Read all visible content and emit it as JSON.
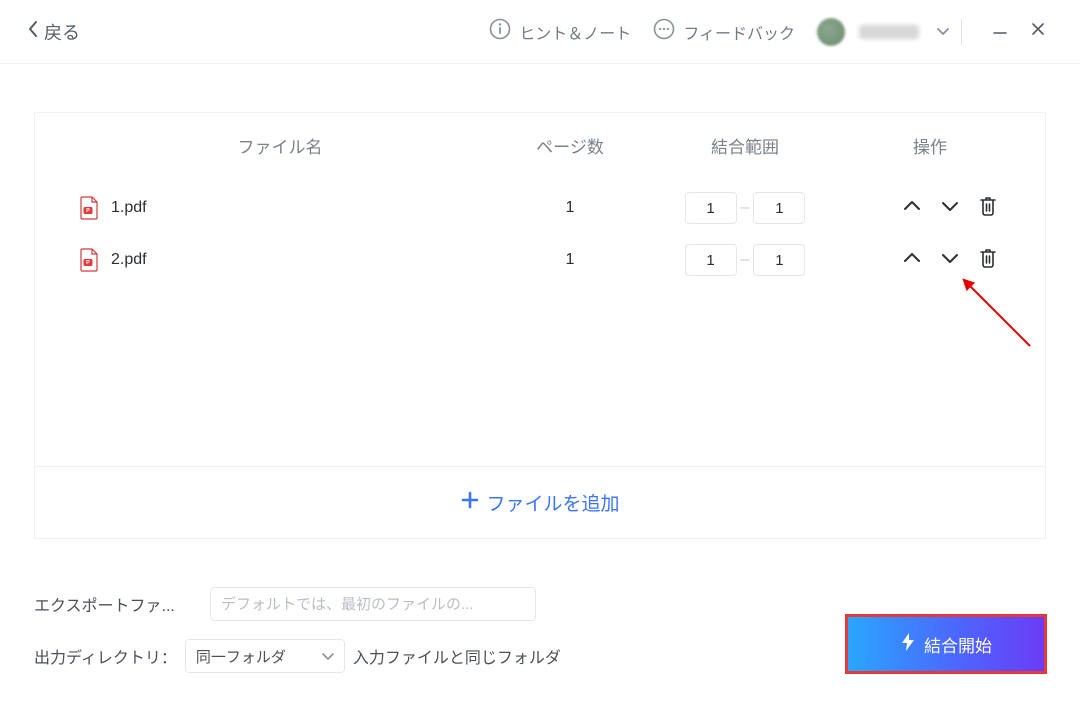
{
  "titlebar": {
    "back_label": "戻る",
    "hint_label": "ヒント＆ノート",
    "feedback_label": "フィードバック"
  },
  "table": {
    "headers": {
      "filename": "ファイル名",
      "pages": "ページ数",
      "range": "結合範囲",
      "ops": "操作"
    },
    "rows": [
      {
        "name": "1.pdf",
        "pages": "1",
        "range_from": "1",
        "range_to": "1"
      },
      {
        "name": "2.pdf",
        "pages": "1",
        "range_from": "1",
        "range_to": "1"
      }
    ]
  },
  "add_file_label": "ファイルを追加",
  "footer": {
    "export_name_label": "エクスポートファ...",
    "export_name_placeholder": "デフォルトでは、最初のファイルの...",
    "outdir_label": "出力ディレクトリ：",
    "outdir_select_value": "同一フォルダ",
    "outdir_suffix": "入力ファイルと同じフォルダ"
  },
  "start_button_label": "結合開始",
  "colors": {
    "accent_blue": "#3a74ff",
    "gradient_start": "#2aa6ff",
    "gradient_end": "#6b3cf5",
    "highlight_border": "#e53a3a"
  }
}
